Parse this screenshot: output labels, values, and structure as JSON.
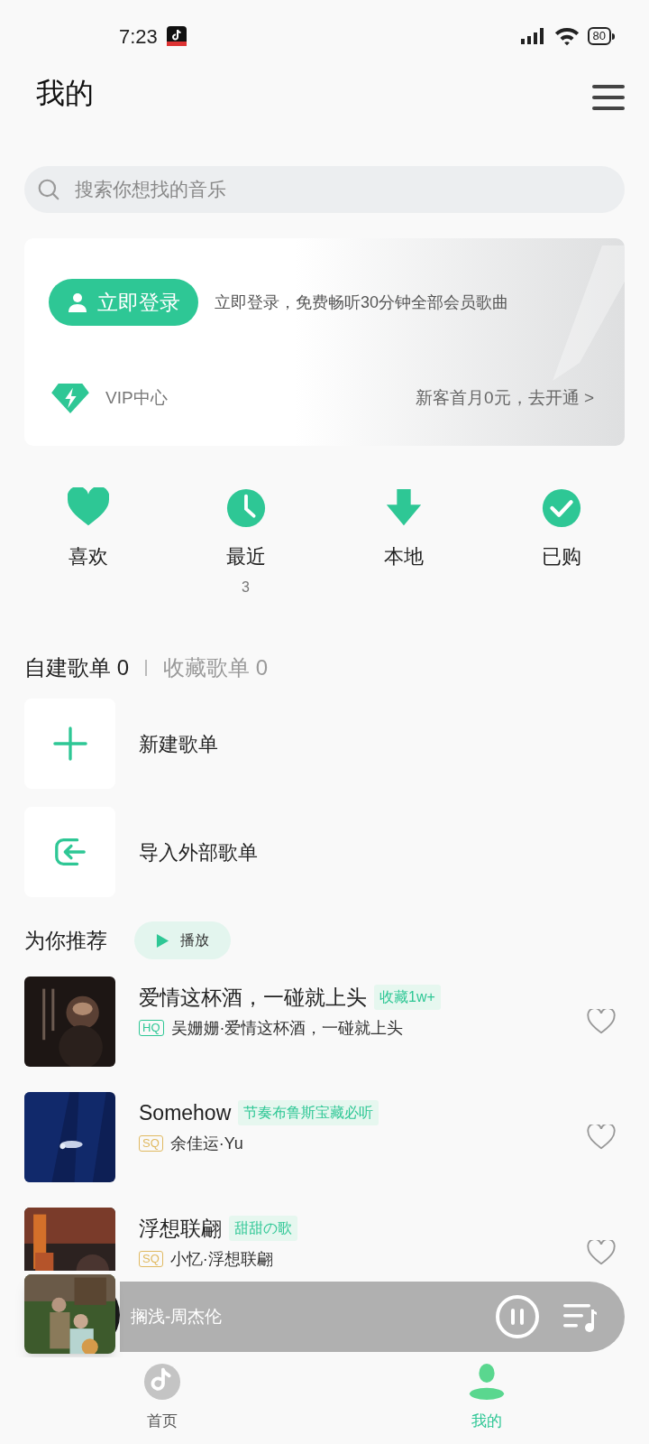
{
  "status_bar": {
    "time": "7:23",
    "battery": "80"
  },
  "title": "我的",
  "search": {
    "placeholder": "搜索你想找的音乐"
  },
  "login_card": {
    "button": "立即登录",
    "promo": "立即登录，免费畅听30分钟全部会员歌曲",
    "vip_label": "VIP中心",
    "vip_offer": "新客首月0元，去开通 >"
  },
  "shortcuts": [
    {
      "kind": "heart",
      "label": "喜欢"
    },
    {
      "kind": "clock",
      "label": "最近",
      "count": "3"
    },
    {
      "kind": "download",
      "label": "本地"
    },
    {
      "kind": "check",
      "label": "已购"
    }
  ],
  "playlist_tabs": [
    {
      "label": "自建歌单",
      "count": "0",
      "selected": true
    },
    {
      "label": "收藏歌单",
      "count": "0",
      "selected": false
    }
  ],
  "playlist_actions": [
    {
      "kind": "create",
      "label": "新建歌单"
    },
    {
      "kind": "import",
      "label": "导入外部歌单"
    }
  ],
  "recommend": {
    "title": "为你推荐",
    "play_button": "播放"
  },
  "songs": [
    {
      "title": "爱情这杯酒，一碰就上头",
      "tag": "收藏1w+",
      "quality": "HQ",
      "color": "#2ec795",
      "subtitle": "吴姗姗·爱情这杯酒，一碰就上头",
      "liked": false
    },
    {
      "title": "Somehow",
      "tag": "节奏布鲁斯宝藏必听",
      "quality": "SQ",
      "color": "#e0b960",
      "subtitle": "余佳运·Yu",
      "liked": false
    },
    {
      "title": "浮想联翩",
      "tag": "甜甜の歌",
      "quality": "SQ",
      "color": "#e0b960",
      "subtitle": "小忆·浮想联翩",
      "liked": false
    }
  ],
  "mini_player": {
    "title": "搁浅-周杰伦",
    "playing": true
  },
  "nav": [
    {
      "label": "首页",
      "selected": false
    },
    {
      "label": "我的",
      "selected": true
    }
  ]
}
